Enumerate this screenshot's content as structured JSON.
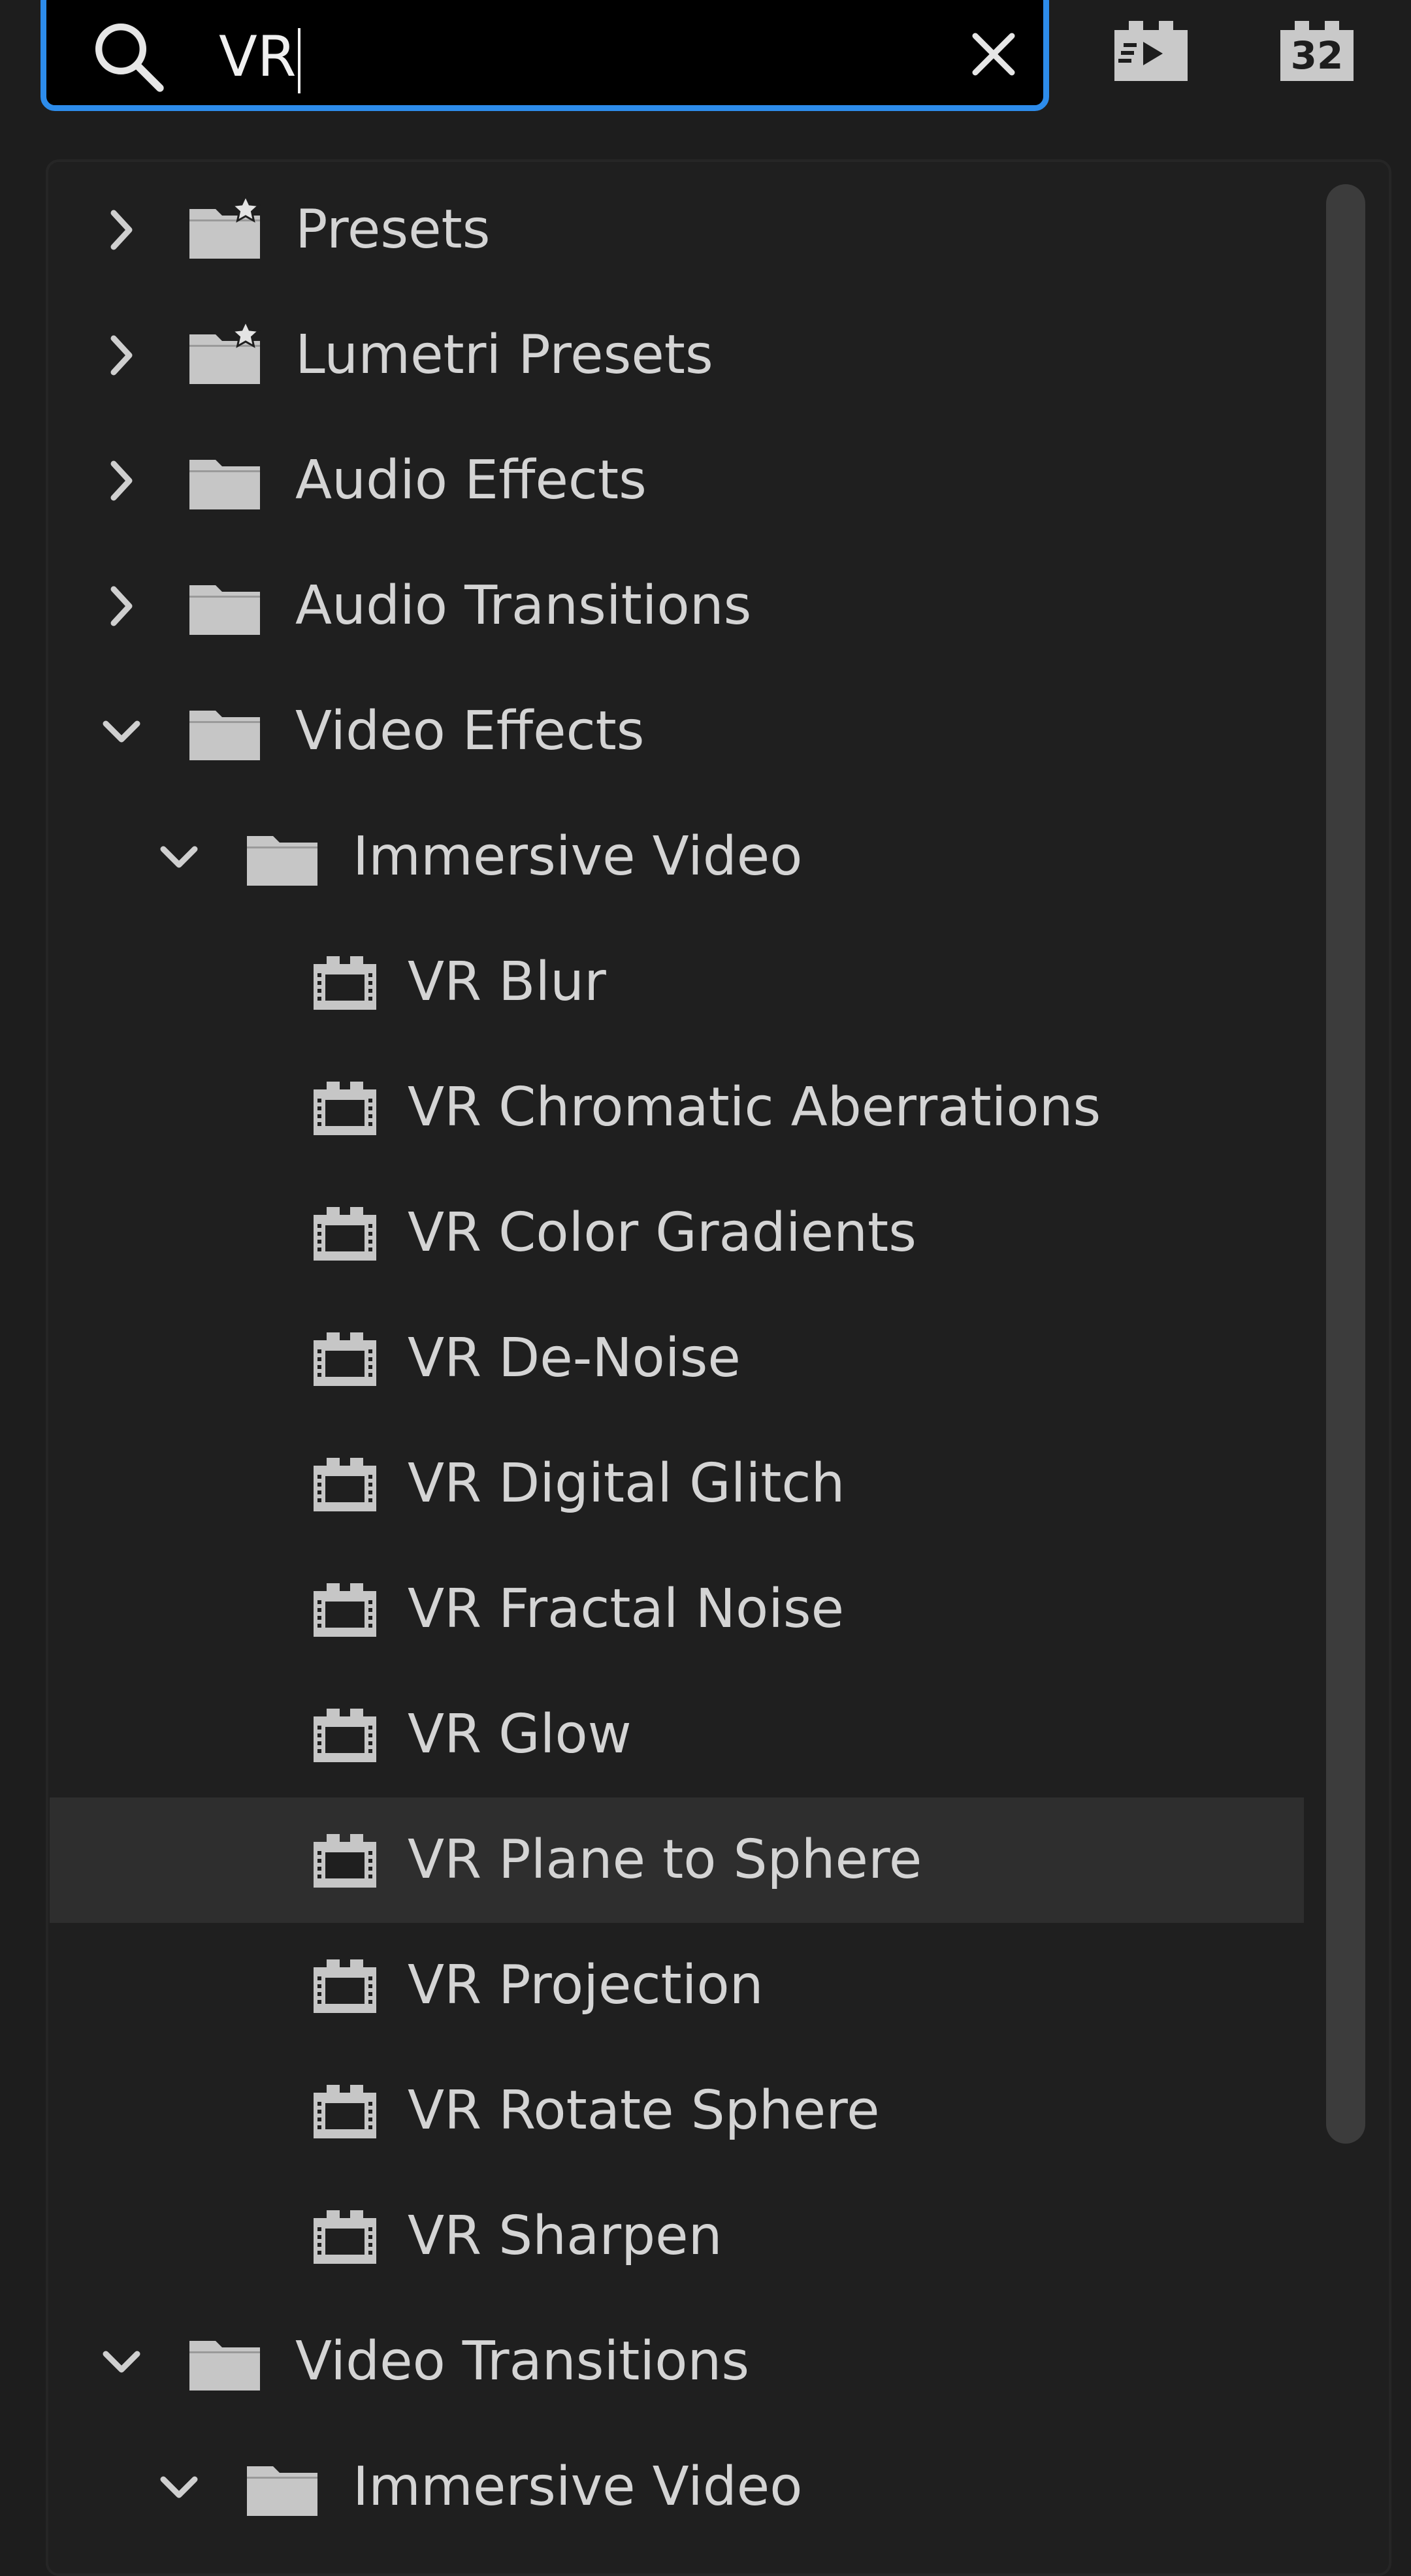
{
  "search": {
    "value": "VR"
  },
  "icons": {
    "search": "search-icon",
    "clear": "close-icon",
    "accelerated": "accelerated-effects-icon",
    "bit32": "32-bit-color-icon",
    "folder": "folder-icon",
    "preset_folder": "preset-folder-star-icon",
    "effect": "effect-film-icon",
    "chevron_right": "chevron-right-icon",
    "chevron_down": "chevron-down-icon"
  },
  "toolbar": {
    "bit32_label": "32"
  },
  "colors": {
    "accent": "#2d8ceb",
    "background": "#1d1d1d",
    "highlight": "#2e2e2e",
    "text": "#d4d4d4"
  },
  "tree": [
    {
      "label": "Presets",
      "level": 0,
      "kind": "preset_folder",
      "expanded": false
    },
    {
      "label": "Lumetri Presets",
      "level": 0,
      "kind": "preset_folder",
      "expanded": false
    },
    {
      "label": "Audio Effects",
      "level": 0,
      "kind": "folder",
      "expanded": false
    },
    {
      "label": "Audio Transitions",
      "level": 0,
      "kind": "folder",
      "expanded": false
    },
    {
      "label": "Video Effects",
      "level": 0,
      "kind": "folder",
      "expanded": true
    },
    {
      "label": "Immersive Video",
      "level": 1,
      "kind": "folder",
      "expanded": true
    },
    {
      "label": "VR Blur",
      "level": 2,
      "kind": "effect"
    },
    {
      "label": "VR Chromatic Aberrations",
      "level": 2,
      "kind": "effect"
    },
    {
      "label": "VR Color Gradients",
      "level": 2,
      "kind": "effect"
    },
    {
      "label": "VR De-Noise",
      "level": 2,
      "kind": "effect"
    },
    {
      "label": "VR Digital Glitch",
      "level": 2,
      "kind": "effect"
    },
    {
      "label": "VR Fractal Noise",
      "level": 2,
      "kind": "effect"
    },
    {
      "label": "VR Glow",
      "level": 2,
      "kind": "effect"
    },
    {
      "label": "VR Plane to Sphere",
      "level": 2,
      "kind": "effect",
      "highlighted": true
    },
    {
      "label": "VR Projection",
      "level": 2,
      "kind": "effect"
    },
    {
      "label": "VR Rotate Sphere",
      "level": 2,
      "kind": "effect"
    },
    {
      "label": "VR Sharpen",
      "level": 2,
      "kind": "effect"
    },
    {
      "label": "Video Transitions",
      "level": 0,
      "kind": "folder",
      "expanded": true
    },
    {
      "label": "Immersive Video",
      "level": 1,
      "kind": "folder",
      "expanded": true
    }
  ]
}
